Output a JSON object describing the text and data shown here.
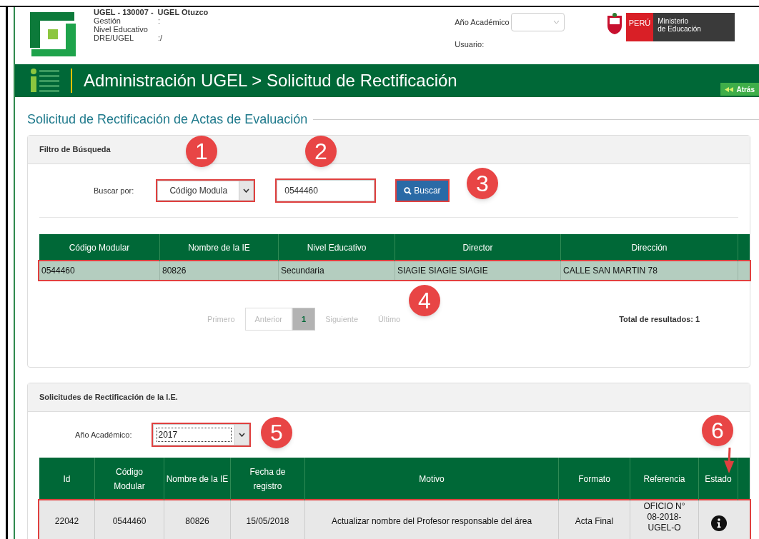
{
  "header": {
    "info": [
      "UGEL - 130007 -",
      "UGEL Otuzco"
    ],
    "fields": [
      {
        "label": "Gestión",
        "value": ":"
      },
      {
        "label": "Nivel Educativo"
      },
      {
        "label": "DRE/UGEL",
        "value": ":/"
      }
    ],
    "year_label": "Año Académico",
    "user_label": "Usuario:",
    "peru": "PERÚ",
    "ministry": [
      "Ministerio",
      "de Educación"
    ]
  },
  "title_bar": {
    "title": "Administración UGEL > Solicitud de Rectificación",
    "back": "Atrás"
  },
  "section_title": "Solicitud de Rectificación de Actas de Evaluación",
  "filter_panel": {
    "title": "Filtro de Búsqueda",
    "label": "Buscar por:",
    "select": {
      "value": "Código Modula",
      "highlighted": true
    },
    "input": {
      "value": "0544460",
      "highlighted": true
    },
    "button": {
      "label": "Buscar",
      "highlighted": true
    },
    "table": {
      "columns": [
        "Código Modular",
        "Nombre de la IE",
        "Nivel Educativo",
        "Director",
        "Dirección"
      ],
      "rows": [
        {
          "cells": [
            "0544460",
            "80826",
            "Secundaria",
            "SIAGIE SIAGIE SIAGIE",
            "CALLE SAN MARTIN 78"
          ],
          "highlighted": true
        }
      ]
    },
    "pagination": {
      "items": [
        {
          "label": "Primero",
          "kind": "link",
          "selected": false
        },
        {
          "label": "Anterior",
          "kind": "box",
          "selected": false
        },
        {
          "label": "1",
          "kind": "box",
          "selected": true
        },
        {
          "label": "Siguiente",
          "kind": "link",
          "selected": false
        },
        {
          "label": "Último",
          "kind": "link",
          "selected": false
        }
      ],
      "total": "Total de resultados: 1"
    }
  },
  "requests_panel": {
    "title": "Solicitudes de Rectificación de la I.E.",
    "year_label": "Año Académico:",
    "year": {
      "value": "2017",
      "highlighted": true
    },
    "table": {
      "columns": [
        "Id",
        "Código Modular",
        "Nombre de la IE",
        "Fecha de registro",
        "Motivo",
        "Formato",
        "Referencia",
        "Estado"
      ],
      "rows": [
        {
          "cells": [
            "22042",
            "0544460",
            "80826",
            "15/05/2018",
            "Actualizar nombre del Profesor responsable del área",
            "Acta Final",
            "OFICIO N° 08-2018-UGEL-O"
          ],
          "highlighted": true
        }
      ]
    }
  },
  "callouts": [
    "1",
    "2",
    "3",
    "4",
    "5",
    "6"
  ]
}
